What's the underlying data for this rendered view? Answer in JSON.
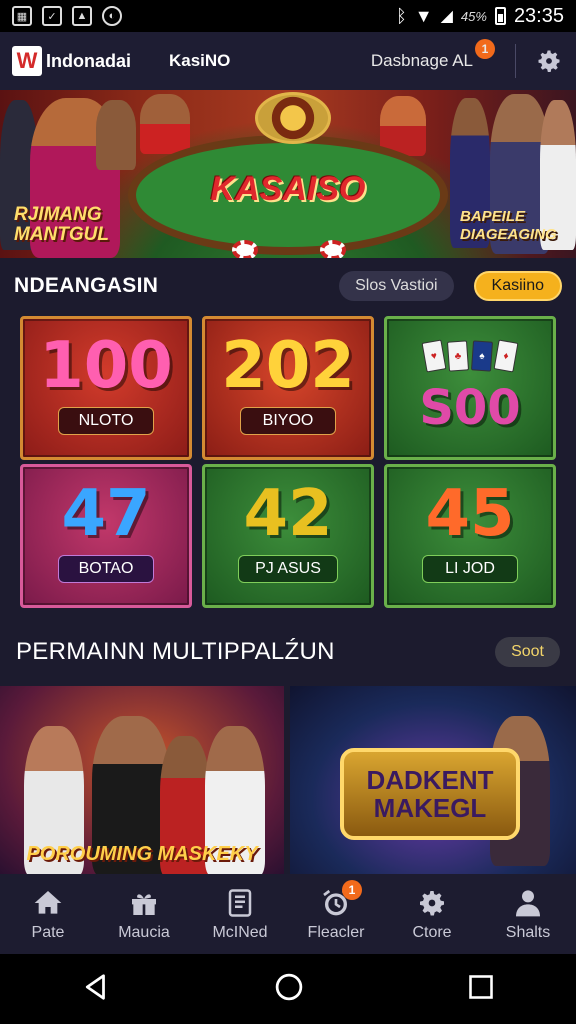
{
  "status_bar": {
    "time": "23:35",
    "battery": "45%"
  },
  "header": {
    "logo_letter": "W",
    "brand": "Indonadai",
    "nav_label": "KasiNO",
    "account_label": "Dasbnage AL",
    "notification_badge": "1",
    "settings_icon": "gear-icon"
  },
  "hero": {
    "title": "KASAISO",
    "left_caption": "RJIMANG\nMANTGUL",
    "right_caption": "BAPEILE\nDIAGEAGING"
  },
  "section_games": {
    "title": "NDEANGASIN",
    "tab_secondary": "Slos Vastioi",
    "tab_primary": "Kasiino"
  },
  "games": [
    {
      "number": "100",
      "label": "NLOTO",
      "color": "#ff4fa3"
    },
    {
      "number": "202",
      "label": "BIYOO",
      "color": "#ffd23a"
    },
    {
      "number": "S00",
      "label": "",
      "color": "#e04aa8"
    },
    {
      "number": "47",
      "label": "BOTAO",
      "color": "#3aa6ff"
    },
    {
      "number": "42",
      "label": "PJ ASUS",
      "color": "#e8c020"
    },
    {
      "number": "45",
      "label": "LI JOD",
      "color": "#ff6a2a"
    }
  ],
  "section_multi": {
    "title": "PERMAINN MULTIPPALŹUN",
    "action": "Soot"
  },
  "promos": [
    {
      "title": "POROUMING MASKEKY"
    },
    {
      "title": "DADKENT\nMAKEGL"
    }
  ],
  "bottom_nav": [
    {
      "label": "Pate",
      "icon": "home-icon"
    },
    {
      "label": "Maucia",
      "icon": "gift-icon"
    },
    {
      "label": "McINed",
      "icon": "document-icon"
    },
    {
      "label": "Fleacler",
      "icon": "alarm-icon",
      "badge": "1"
    },
    {
      "label": "Ctore",
      "icon": "gear-icon"
    },
    {
      "label": "Shalts",
      "icon": "person-icon"
    }
  ],
  "colors": {
    "background": "#1c1b2e",
    "accent_gold": "#f5b11d",
    "badge": "#f26a1b"
  }
}
